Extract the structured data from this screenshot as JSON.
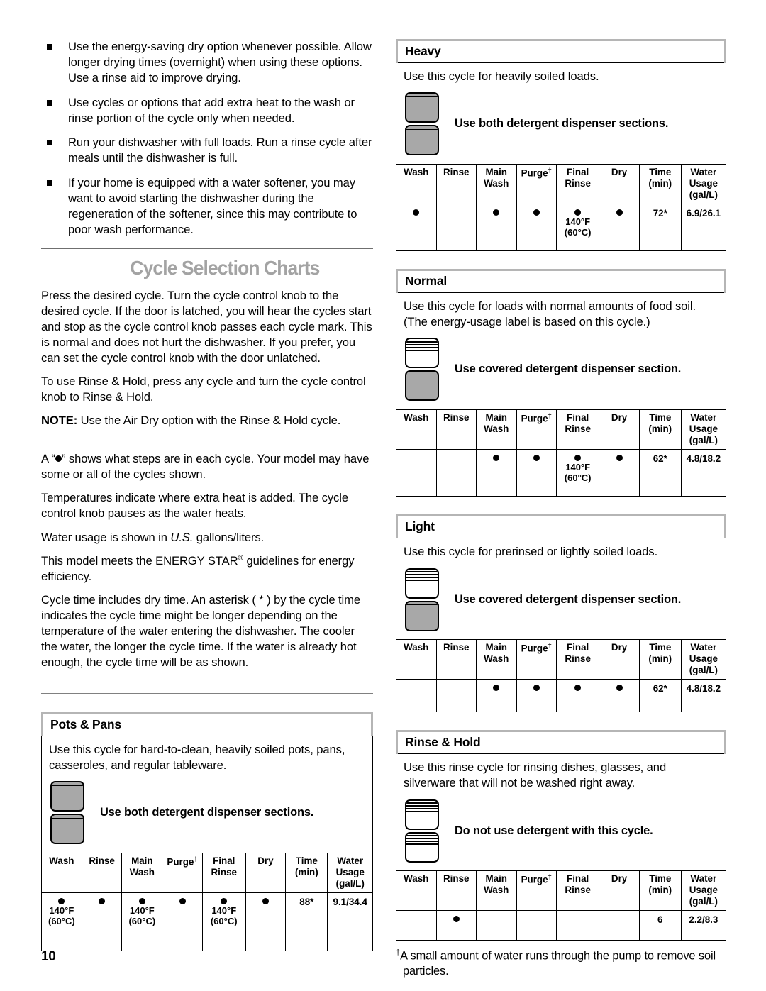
{
  "page": {
    "number": "10"
  },
  "intro_bullets": [
    "Use the energy-saving dry option whenever possible. Allow longer drying times (overnight) when using these options. Use a rinse aid to improve drying.",
    "Use cycles or options that add extra heat to the wash or rinse portion of the cycle only when needed.",
    "Run your dishwasher with full loads. Run a rinse cycle after meals until the dishwasher is full.",
    "If your home is equipped with a water softener, you may want to avoid starting the dishwasher during the regeneration of the softener, since this may contribute to poor wash performance."
  ],
  "section_title": "Cycle Selection Charts",
  "intro_paragraphs": {
    "p1": "Press the desired cycle. Turn the cycle control knob to the desired cycle. If the door is latched, you will hear the cycles start and stop as the cycle control knob passes each cycle mark. This is normal and does not hurt the dishwasher. If you prefer, you can set the cycle control knob with the door unlatched.",
    "p2": "To use Rinse & Hold, press any cycle and turn the cycle control knob to Rinse & Hold.",
    "p3_label": "NOTE:",
    "p3_text": "Use the Air Dry option with the Rinse & Hold cycle.",
    "p4_pre": "A “",
    "p4_post": "” shows what steps are in each cycle. Your model may have some or all of the cycles shown.",
    "p5": "Temperatures indicate where extra heat is added. The cycle control knob pauses as the water heats.",
    "p6_pre": "Water usage is shown in ",
    "p6_italic": "U.S.",
    "p6_post": " gallons/liters.",
    "p7_pre": "This model meets the ENERGY STAR",
    "p7_sup": "®",
    "p7_post": " guidelines for energy efficiency.",
    "p8": "Cycle time includes dry time. An asterisk ( * ) by the cycle time indicates the cycle time might be longer depending on the temperature of the water entering the dishwasher. The cooler the water, the longer the cycle time. If the water is already hot enough, the cycle time will be as shown."
  },
  "table_headers": {
    "wash": "Wash",
    "rinse": "Rinse",
    "main_wash": "Main Wash",
    "purge": "Purge",
    "purge_dagger": "†",
    "final_rinse": "Final Rinse",
    "dry": "Dry",
    "time": "Time (min)",
    "water_usage": "Water Usage (gal/L)"
  },
  "cycles": {
    "pots_and_pans": {
      "title": "Pots & Pans",
      "description": "Use this cycle for hard-to-clean, heavily soiled pots, pans, casseroles, and regular tableware.",
      "dispenser_note": "Use both detergent dispenser sections.",
      "dispenser_icon": "both-sections-filled",
      "row": {
        "wash": {
          "dot": true,
          "temp_f": "140°F",
          "temp_c": "(60°C)"
        },
        "rinse": {
          "dot": true
        },
        "main_wash": {
          "dot": true,
          "temp_f": "140°F",
          "temp_c": "(60°C)"
        },
        "purge": {
          "dot": true
        },
        "final_rinse": {
          "dot": true,
          "temp_f": "140°F",
          "temp_c": "(60°C)"
        },
        "dry": {
          "dot": true
        },
        "time": "88*",
        "water_usage": "9.1/34.4"
      }
    },
    "heavy": {
      "title": "Heavy",
      "description": "Use this cycle for heavily soiled loads.",
      "dispenser_note": "Use both detergent dispenser sections.",
      "dispenser_icon": "both-sections-filled",
      "row": {
        "wash": {
          "dot": true
        },
        "rinse": {
          "dot": false
        },
        "main_wash": {
          "dot": true
        },
        "purge": {
          "dot": true
        },
        "final_rinse": {
          "dot": true,
          "temp_f": "140°F",
          "temp_c": "(60°C)"
        },
        "dry": {
          "dot": true
        },
        "time": "72*",
        "water_usage": "6.9/26.1"
      }
    },
    "normal": {
      "title": "Normal",
      "description": "Use this cycle for loads with normal amounts of food soil. (The energy-usage label is based on this cycle.)",
      "dispenser_note": "Use covered detergent dispenser section.",
      "dispenser_icon": "covered-top-open-bottom-filled",
      "row": {
        "wash": {
          "dot": false
        },
        "rinse": {
          "dot": false
        },
        "main_wash": {
          "dot": true
        },
        "purge": {
          "dot": true
        },
        "final_rinse": {
          "dot": true,
          "temp_f": "140°F",
          "temp_c": "(60°C)"
        },
        "dry": {
          "dot": true
        },
        "time": "62*",
        "water_usage": "4.8/18.2"
      }
    },
    "light": {
      "title": "Light",
      "description": "Use this cycle for prerinsed or lightly soiled loads.",
      "dispenser_note": "Use covered detergent dispenser section.",
      "dispenser_icon": "covered-top-open-bottom-filled",
      "row": {
        "wash": {
          "dot": false
        },
        "rinse": {
          "dot": false
        },
        "main_wash": {
          "dot": true
        },
        "purge": {
          "dot": true
        },
        "final_rinse": {
          "dot": true
        },
        "dry": {
          "dot": true
        },
        "time": "62*",
        "water_usage": "4.8/18.2"
      }
    },
    "rinse_and_hold": {
      "title": "Rinse & Hold",
      "description": "Use this rinse cycle for rinsing dishes, glasses, and silverware that will not be washed right away.",
      "dispenser_note": "Do not use detergent with this cycle.",
      "dispenser_icon": "both-sections-covered-empty",
      "row": {
        "wash": {
          "dot": false
        },
        "rinse": {
          "dot": true
        },
        "main_wash": {
          "dot": false
        },
        "purge": {
          "dot": false
        },
        "final_rinse": {
          "dot": false
        },
        "dry": {
          "dot": false
        },
        "time": "6",
        "water_usage": "2.2/8.3"
      }
    }
  },
  "footnote": {
    "dagger": "†",
    "text": "A small amount of water runs through the pump to remove soil particles."
  }
}
